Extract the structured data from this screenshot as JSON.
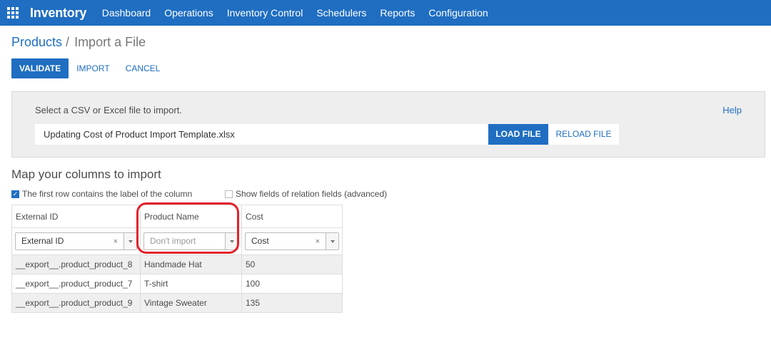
{
  "navbar": {
    "brand": "Inventory",
    "menu": [
      "Dashboard",
      "Operations",
      "Inventory Control",
      "Schedulers",
      "Reports",
      "Configuration"
    ]
  },
  "breadcrumb": {
    "parent": "Products",
    "separator": "/",
    "current": "Import a File"
  },
  "actions": {
    "validate": "VALIDATE",
    "import": "IMPORT",
    "cancel": "CANCEL"
  },
  "file_panel": {
    "prompt": "Select a CSV or Excel file to import.",
    "help": "Help",
    "file_name": "Updating Cost of Product Import Template.xlsx",
    "load_button": "LOAD FILE",
    "reload_button": "RELOAD FILE"
  },
  "mapping": {
    "title": "Map your columns to import",
    "first_row_label": "The first row contains the label of the column",
    "first_row_checked": true,
    "show_relation_label": "Show fields of relation fields (advanced)",
    "show_relation_checked": false,
    "columns": [
      "External ID",
      "Product Name",
      "Cost"
    ],
    "selects": [
      {
        "value": "External ID",
        "placeholder": false,
        "clearable": true
      },
      {
        "value": "Don't import",
        "placeholder": true,
        "clearable": false
      },
      {
        "value": "Cost",
        "placeholder": false,
        "clearable": true
      }
    ],
    "clear_glyph": "×",
    "rows": [
      [
        "__export__.product_product_8",
        "Handmade Hat",
        "50"
      ],
      [
        "__export__.product_product_7",
        "T-shirt",
        "100"
      ],
      [
        "__export__.product_product_9",
        "Vintage Sweater",
        "135"
      ]
    ]
  },
  "colors": {
    "primary": "#1f6ec1",
    "annotation": "#e2222b"
  }
}
